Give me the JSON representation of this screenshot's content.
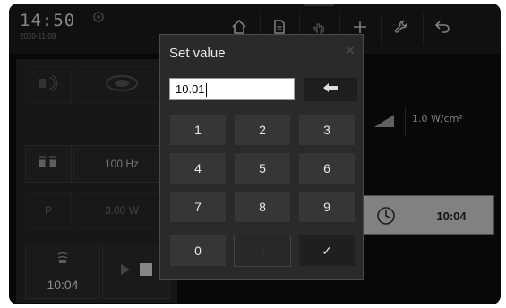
{
  "clock": {
    "time": "14:50",
    "date": "2020-11-09"
  },
  "nav": [
    {
      "name": "home-icon"
    },
    {
      "name": "document-icon"
    },
    {
      "name": "hand-icon"
    },
    {
      "name": "plus-icon"
    },
    {
      "name": "wrench-icon"
    },
    {
      "name": "back-icon"
    }
  ],
  "left_panel": {
    "frequency": "100 Hz",
    "power_label": "P",
    "power_value": "3.00 W",
    "treatment_time": "10:04"
  },
  "right_panel": {
    "intensity": "1.0 W/cm²",
    "timer": "10:04"
  },
  "dialog": {
    "title": "Set value",
    "input_value": "10.01",
    "keys": [
      "1",
      "2",
      "3",
      "4",
      "5",
      "6",
      "7",
      "8",
      "9",
      "0",
      ":",
      "✓"
    ]
  },
  "colors": {
    "background": "#000000",
    "dialog": "#2a2a2a",
    "key": "#363636",
    "timer_box": "#d0d0d0"
  }
}
